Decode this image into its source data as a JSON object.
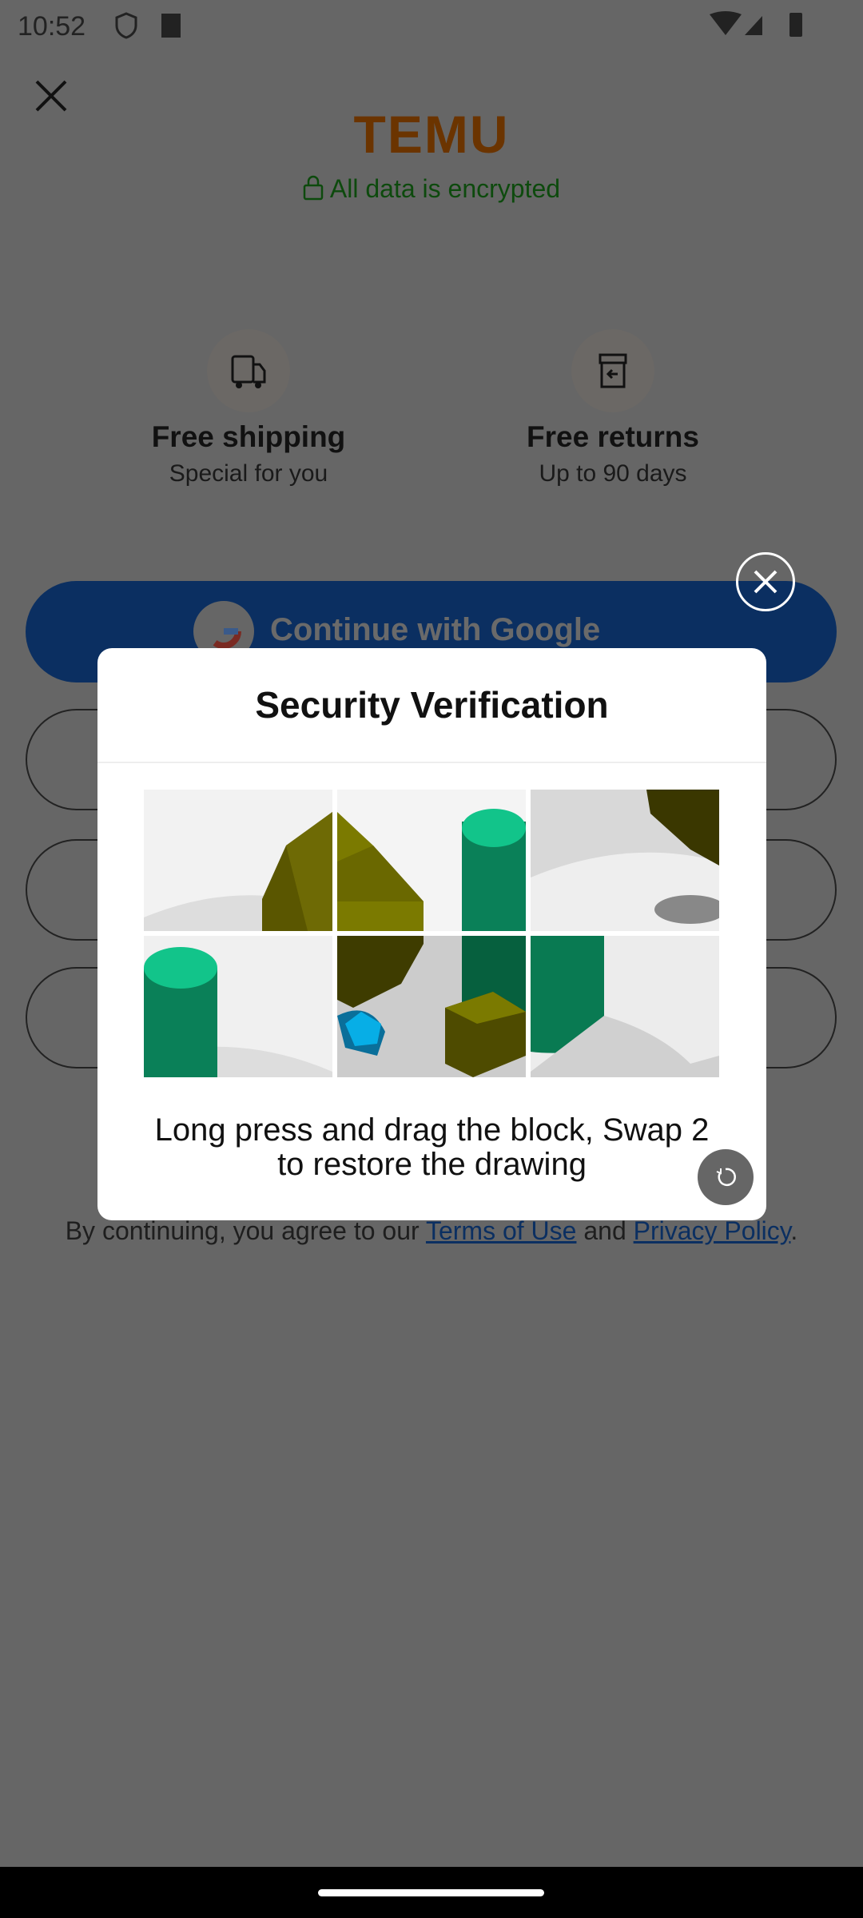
{
  "status_bar": {
    "time": "10:52"
  },
  "header": {
    "logo": "TEMU",
    "encrypted": "All data is encrypted"
  },
  "features": [
    {
      "title": "Free shipping",
      "subtitle": "Special for you",
      "icon": "truck-icon"
    },
    {
      "title": "Free returns",
      "subtitle": "Up to 90 days",
      "icon": "return-box-icon"
    }
  ],
  "buttons": {
    "google": "Continue with Google"
  },
  "modal": {
    "title": "Security Verification",
    "instruction": "Long press and drag the block, Swap 2 to restore the drawing"
  },
  "terms": {
    "prefix": "By continuing, you agree to our ",
    "terms_link": "Terms of Use",
    "and": " and ",
    "privacy_link": "Privacy Policy",
    "suffix": "."
  }
}
